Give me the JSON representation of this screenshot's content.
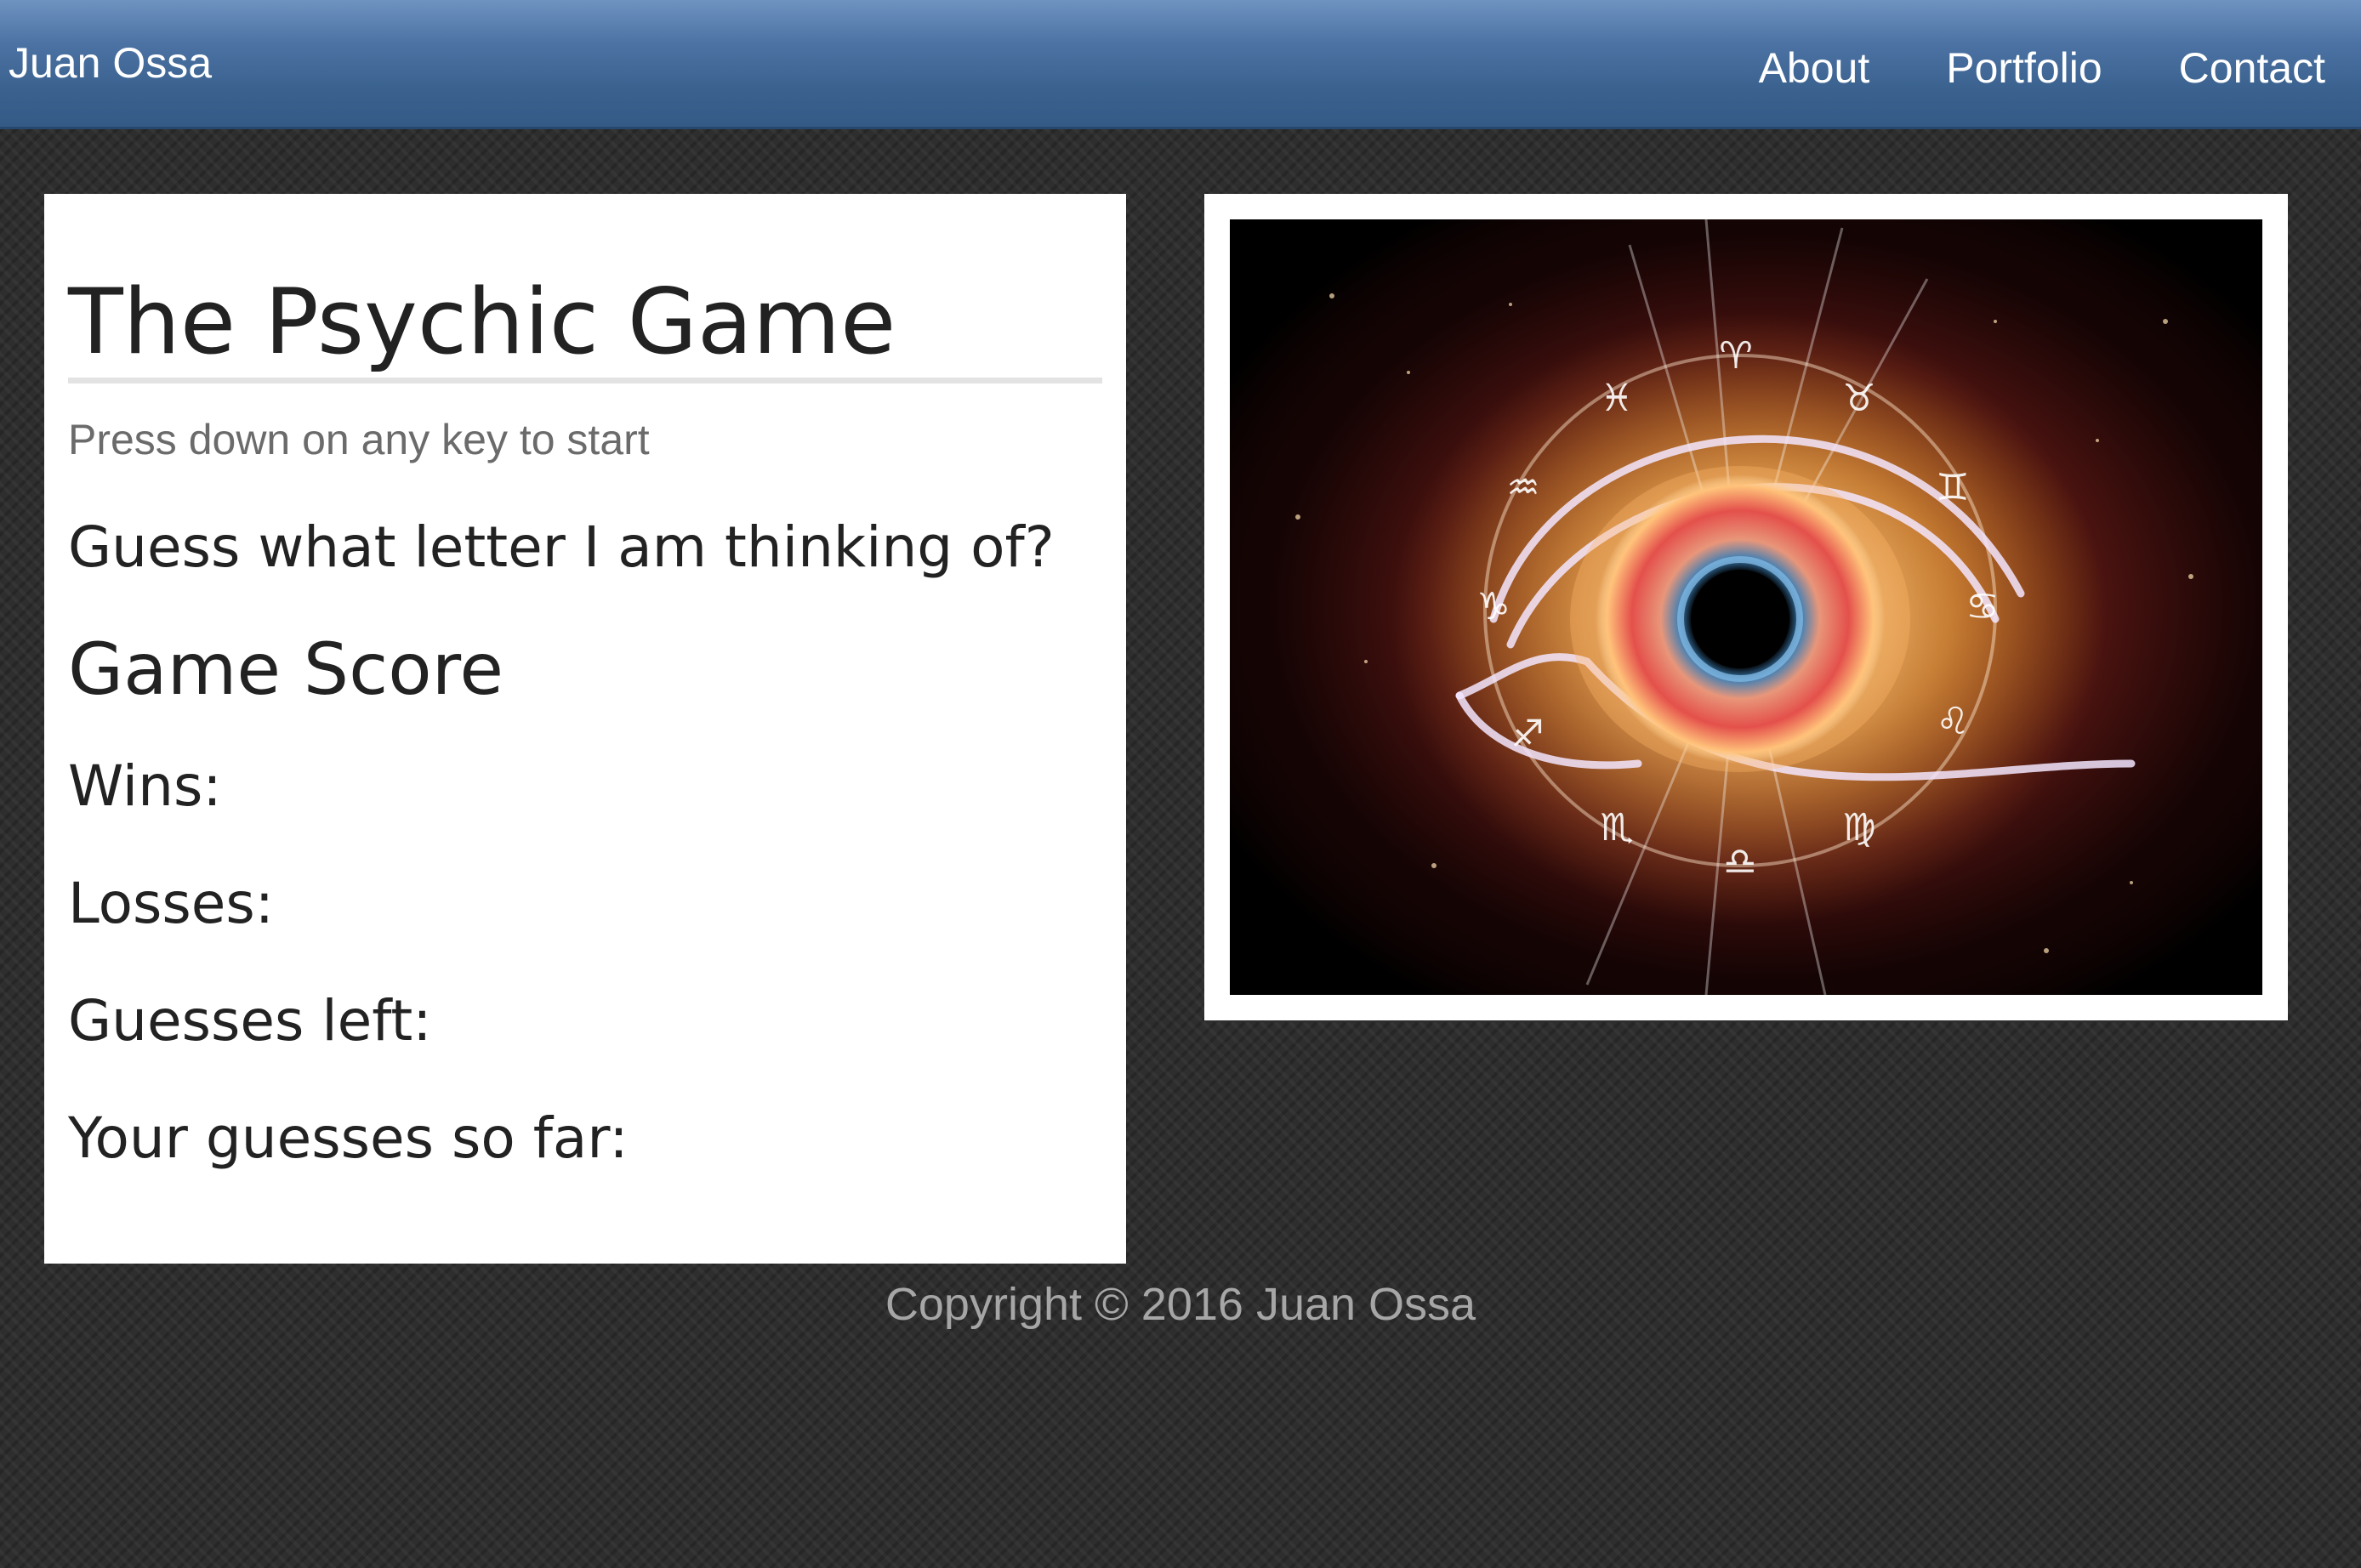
{
  "navbar": {
    "brand": "Juan Ossa",
    "links": [
      {
        "label": "About"
      },
      {
        "label": "Portfolio"
      },
      {
        "label": "Contact"
      }
    ],
    "color": "#4b72a3"
  },
  "game": {
    "title": "The Psychic Game",
    "subtitle": "Press down on any key to start",
    "prompt": "Guess what letter I am thinking of?",
    "score_heading": "Game Score",
    "wins_label": "Wins:",
    "wins_value": "",
    "losses_label": "Losses:",
    "losses_value": "",
    "guesses_left_label": "Guesses left:",
    "guesses_left_value": "",
    "guesses_so_far_label": "Your guesses so far:",
    "guesses_so_far_value": ""
  },
  "image": {
    "subject": "zodiac-eye-illustration"
  },
  "footer": {
    "copyright": "Copyright © 2016 Juan Ossa"
  }
}
